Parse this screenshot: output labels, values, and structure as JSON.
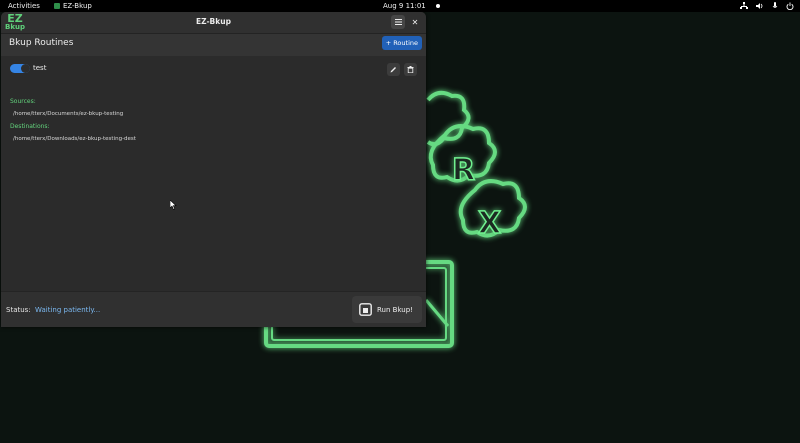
{
  "topbar": {
    "activities": "Activities",
    "app_name": "EZ-Bkup",
    "clock": "Aug 9  11:01"
  },
  "window": {
    "title": "EZ-Bkup",
    "logo_line1": "EZ",
    "logo_line2": "Bkup",
    "header": "Bkup Routines",
    "add_routine": "+ Routine"
  },
  "routine": {
    "name": "test",
    "enabled": true,
    "sources_label": "Sources:",
    "source_path": "/home/tterx/Documents/ez-bkup-testing",
    "destinations_label": "Destinations:",
    "destination_path": "/home/tterx/Downloads/ez-bkup-testing-dest"
  },
  "footer": {
    "status_label": "Status:",
    "status_text": "Waiting patiently...",
    "run_button": "Run Bkup!"
  },
  "colors": {
    "accent_blue": "#2161b8",
    "toggle_blue": "#3584e4",
    "label_green": "#63d47d",
    "status_blue": "#7bb8f0",
    "wallpaper_glow": "#5fe080"
  }
}
